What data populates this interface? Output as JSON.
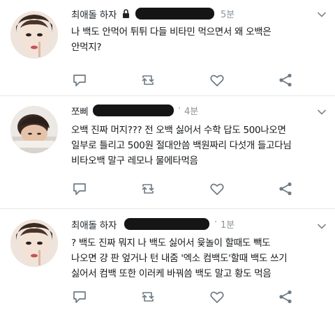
{
  "tweets": [
    {
      "author": "최애돌 하자",
      "time": "5분",
      "lines": [
        "나 백도 안먹어 튀튀 다들 비타민 먹으면서 왜 오백은",
        "안먹지?"
      ]
    },
    {
      "author": "쪼삐",
      "separator": "·",
      "time": "4분",
      "lines": [
        "오백 진짜 머지??? 전 오백 싫어서 수학 답도 500나오면",
        "일부로 틀리고 500원 절대안씀 백원짜리 다섯개 들고다님",
        "비타오백 말구 레모나 물에타먹음"
      ]
    },
    {
      "author": "최애돌 하자",
      "separator": "·",
      "time": "1분",
      "lines": [
        "? 백도 진짜 뭐지 나 백도 싫어서 윷놀이 할때도 빽도",
        "나오면 걍 판 엎거나 턴 내줌 '엑소 컴백도'할때 백도 쓰기",
        "싫어서 컴백 또한 이러케 바꿔씀 백도 말고 황도 먹음"
      ]
    }
  ],
  "icons": [
    "reply-icon",
    "retweet-icon",
    "like-icon",
    "share-icon",
    "chevron-down-icon",
    "lock-icon"
  ],
  "colors": {
    "text": "#14171a",
    "muted": "#8a949c",
    "icon": "#6e7a84",
    "divider": "#e3e6e8",
    "redact": "#151515"
  }
}
